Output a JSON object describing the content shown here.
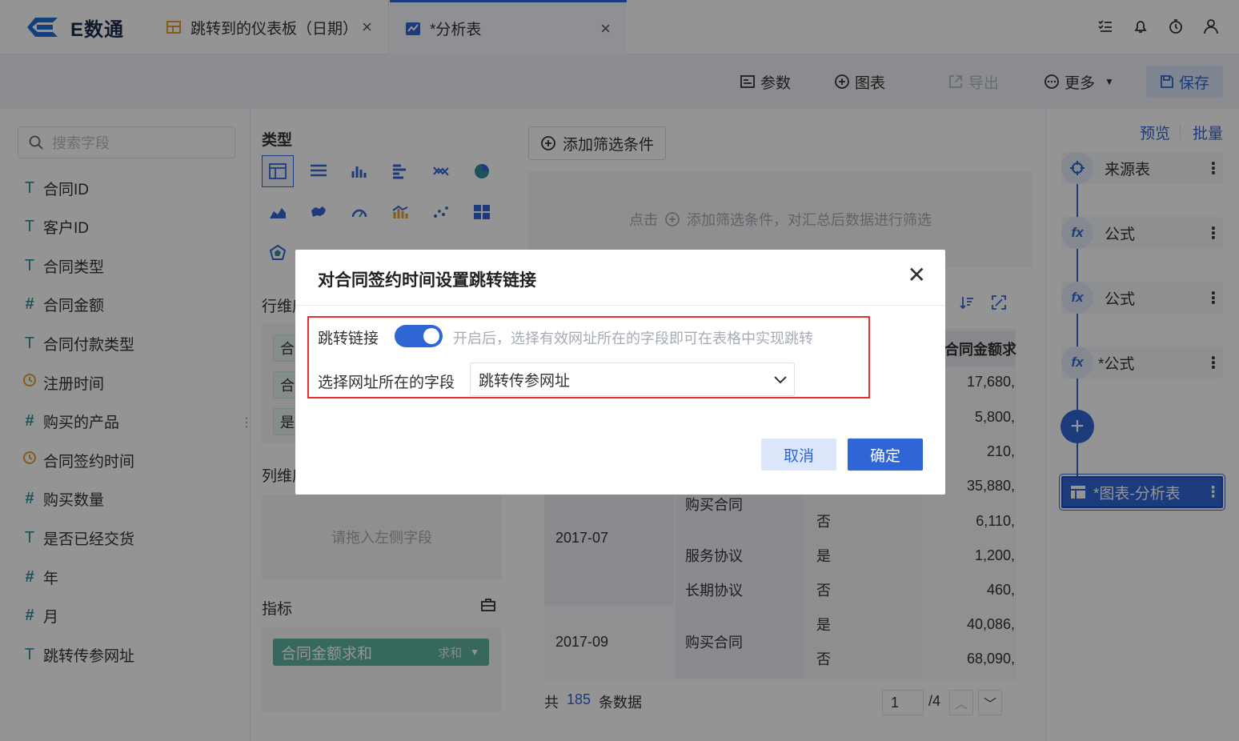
{
  "app": {
    "logo_text": "E数通"
  },
  "tabs": [
    {
      "label": "跳转到的仪表板（日期）",
      "close": "×"
    },
    {
      "label": "*分析表",
      "close": "×"
    }
  ],
  "toolbar": {
    "params": "参数",
    "chart": "图表",
    "export": "导出",
    "more": "更多",
    "save": "保存"
  },
  "fields": {
    "search_placeholder": "搜索字段",
    "items": [
      {
        "type": "T",
        "label": "合同ID"
      },
      {
        "type": "T",
        "label": "客户ID"
      },
      {
        "type": "T",
        "label": "合同类型"
      },
      {
        "type": "#",
        "label": "合同金额"
      },
      {
        "type": "T",
        "label": "合同付款类型"
      },
      {
        "type": "clock",
        "label": "注册时间"
      },
      {
        "type": "#",
        "label": "购买的产品"
      },
      {
        "type": "clock",
        "label": "合同签约时间"
      },
      {
        "type": "#",
        "label": "购买数量"
      },
      {
        "type": "T",
        "label": "是否已经交货"
      },
      {
        "type": "#",
        "label": "年"
      },
      {
        "type": "#",
        "label": "月"
      },
      {
        "type": "T",
        "label": "跳转传参网址"
      }
    ]
  },
  "config": {
    "type_label": "类型",
    "row_dim_label": "行维度",
    "col_dim_label": "列维度",
    "col_placeholder": "请拖入左侧字段",
    "metric_label": "指标",
    "metric_pill": "合同金额求和",
    "metric_agg": "求和",
    "row_pills": [
      "合",
      "合",
      "是"
    ]
  },
  "filter": {
    "add_button": "添加筛选条件",
    "hint_prefix": "点击",
    "hint_suffix": "添加筛选条件，对汇总后数据进行筛选"
  },
  "table": {
    "metric_header": "合同金额求",
    "values": [
      "17,680,",
      "5,800,",
      "210,",
      "35,880,",
      "6,110,",
      "1,200,",
      "460,",
      "40,086,",
      "68,090,"
    ],
    "months": [
      "2017-07",
      "2017-09"
    ],
    "types": [
      "购买合同",
      "服务协议",
      "长期协议",
      "购买合同"
    ],
    "delivered": [
      "否",
      "是",
      "否",
      "是",
      "否"
    ],
    "footer_prefix": "共",
    "footer_count": "185",
    "footer_suffix": "条数据",
    "page_current": "1",
    "page_total": "/4"
  },
  "flow": {
    "preview": "预览",
    "batch": "批量",
    "nodes": [
      "来源表",
      "公式",
      "公式",
      "*公式"
    ],
    "chart_node": "*图表-分析表"
  },
  "modal": {
    "title": "对合同签约时间设置跳转链接",
    "jump_label": "跳转链接",
    "toggle_on": true,
    "hint": "开启后，选择有效网址所在的字段即可在表格中实现跳转",
    "field_label": "选择网址所在的字段",
    "selected_field": "跳转传参网址",
    "cancel": "取消",
    "ok": "确定"
  },
  "colors": {
    "primary": "#2f66d6",
    "highlight_border": "#e2302f",
    "teal": "#2f8f9a"
  }
}
